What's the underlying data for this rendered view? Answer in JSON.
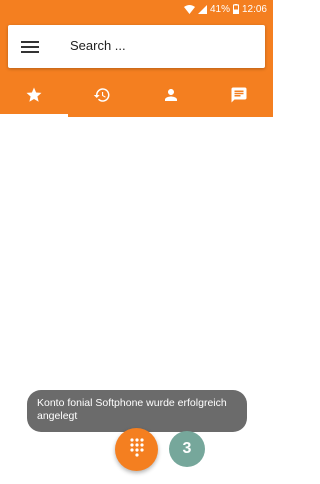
{
  "status_bar": {
    "battery": "41%",
    "time": "12:06",
    "icons": [
      "wifi-icon",
      "signal-icon",
      "battery-icon"
    ]
  },
  "search": {
    "placeholder": "Search ..."
  },
  "tabs": [
    {
      "icon": "star-icon",
      "active": true
    },
    {
      "icon": "history-icon",
      "active": false
    },
    {
      "icon": "person-icon",
      "active": false
    },
    {
      "icon": "message-icon",
      "active": false
    }
  ],
  "toast": {
    "message": "Konto fonial Softphone wurde erfolgreich angelegt"
  },
  "badge": {
    "count": "3"
  },
  "colors": {
    "primary": "#f47f20",
    "badge": "#76a79b",
    "toast_bg": "#6b6b6b"
  }
}
